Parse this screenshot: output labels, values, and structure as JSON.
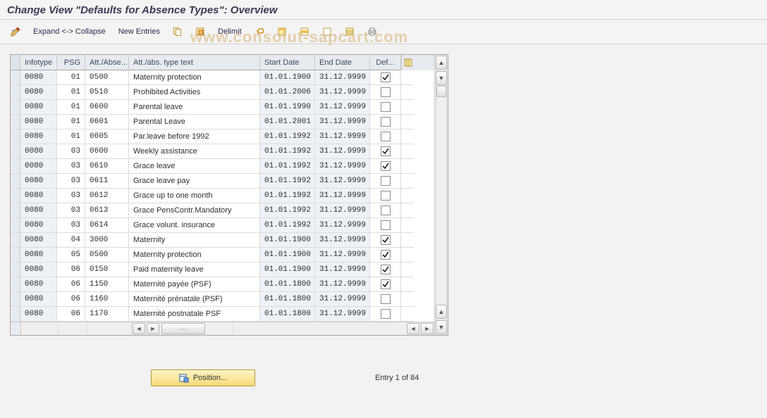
{
  "title": "Change View \"Defaults for Absence Types\": Overview",
  "toolbar": {
    "expand_collapse": "Expand <-> Collapse",
    "new_entries": "New Entries",
    "delimit": "Delimit"
  },
  "icons": {
    "pencil": "pencil-toggle-icon",
    "copy": "copy-icon",
    "variant": "variant-icon",
    "undo": "undo-icon",
    "selall": "select-all-icon",
    "selblk": "select-block-icon",
    "desel": "deselect-all-icon",
    "cfgcol": "configure-columns-icon",
    "position": "position-icon"
  },
  "columns": {
    "infotype": "Infotype",
    "psg": "PSG",
    "abs": "Att./Abse...",
    "text": "Att./abs. type text",
    "start": "Start Date",
    "end": "End Date",
    "def": "Def..."
  },
  "rows": [
    {
      "infotype": "0080",
      "psg": "01",
      "abs": "0500",
      "text": "Maternity protection",
      "start": "01.01.1900",
      "end": "31.12.9999",
      "def": true
    },
    {
      "infotype": "0080",
      "psg": "01",
      "abs": "0510",
      "text": "Prohibited Activities",
      "start": "01.01.2006",
      "end": "31.12.9999",
      "def": false
    },
    {
      "infotype": "0080",
      "psg": "01",
      "abs": "0600",
      "text": "Parental leave",
      "start": "01.01.1990",
      "end": "31.12.9999",
      "def": false
    },
    {
      "infotype": "0080",
      "psg": "01",
      "abs": "0601",
      "text": "Parental Leave",
      "start": "01.01.2001",
      "end": "31.12.9999",
      "def": false
    },
    {
      "infotype": "0080",
      "psg": "01",
      "abs": "0605",
      "text": "Par.leave before 1992",
      "start": "01.01.1992",
      "end": "31.12.9999",
      "def": false
    },
    {
      "infotype": "0080",
      "psg": "03",
      "abs": "0600",
      "text": "Weekly assistance",
      "start": "01.01.1992",
      "end": "31.12.9999",
      "def": true
    },
    {
      "infotype": "0080",
      "psg": "03",
      "abs": "0610",
      "text": "Grace leave",
      "start": "01.01.1992",
      "end": "31.12.9999",
      "def": true
    },
    {
      "infotype": "0080",
      "psg": "03",
      "abs": "0611",
      "text": "Grace leave pay",
      "start": "01.01.1992",
      "end": "31.12.9999",
      "def": false
    },
    {
      "infotype": "0080",
      "psg": "03",
      "abs": "0612",
      "text": "Grace up to one month",
      "start": "01.01.1992",
      "end": "31.12.9999",
      "def": false
    },
    {
      "infotype": "0080",
      "psg": "03",
      "abs": "0613",
      "text": "Grace PensContr.Mandatory",
      "start": "01.01.1992",
      "end": "31.12.9999",
      "def": false
    },
    {
      "infotype": "0080",
      "psg": "03",
      "abs": "0614",
      "text": "Grace volunt. insurance",
      "start": "01.01.1992",
      "end": "31.12.9999",
      "def": false
    },
    {
      "infotype": "0080",
      "psg": "04",
      "abs": "3000",
      "text": "Maternity",
      "start": "01.01.1900",
      "end": "31.12.9999",
      "def": true
    },
    {
      "infotype": "0080",
      "psg": "05",
      "abs": "0500",
      "text": "Maternity protection",
      "start": "01.01.1900",
      "end": "31.12.9999",
      "def": true
    },
    {
      "infotype": "0080",
      "psg": "06",
      "abs": "0150",
      "text": "Paid maternity leave",
      "start": "01.01.1900",
      "end": "31.12.9999",
      "def": true
    },
    {
      "infotype": "0080",
      "psg": "06",
      "abs": "1150",
      "text": "Maternité payée (PSF)",
      "start": "01.01.1800",
      "end": "31.12.9999",
      "def": true
    },
    {
      "infotype": "0080",
      "psg": "06",
      "abs": "1160",
      "text": "Maternité prénatale (PSF)",
      "start": "01.01.1800",
      "end": "31.12.9999",
      "def": false
    },
    {
      "infotype": "0080",
      "psg": "06",
      "abs": "1170",
      "text": "Maternité postnatale PSF",
      "start": "01.01.1800",
      "end": "31.12.9999",
      "def": false
    }
  ],
  "footer": {
    "position_label": "Position...",
    "entry_text": "Entry 1 of 84"
  },
  "watermark": "www.consolut-sapcart.com"
}
